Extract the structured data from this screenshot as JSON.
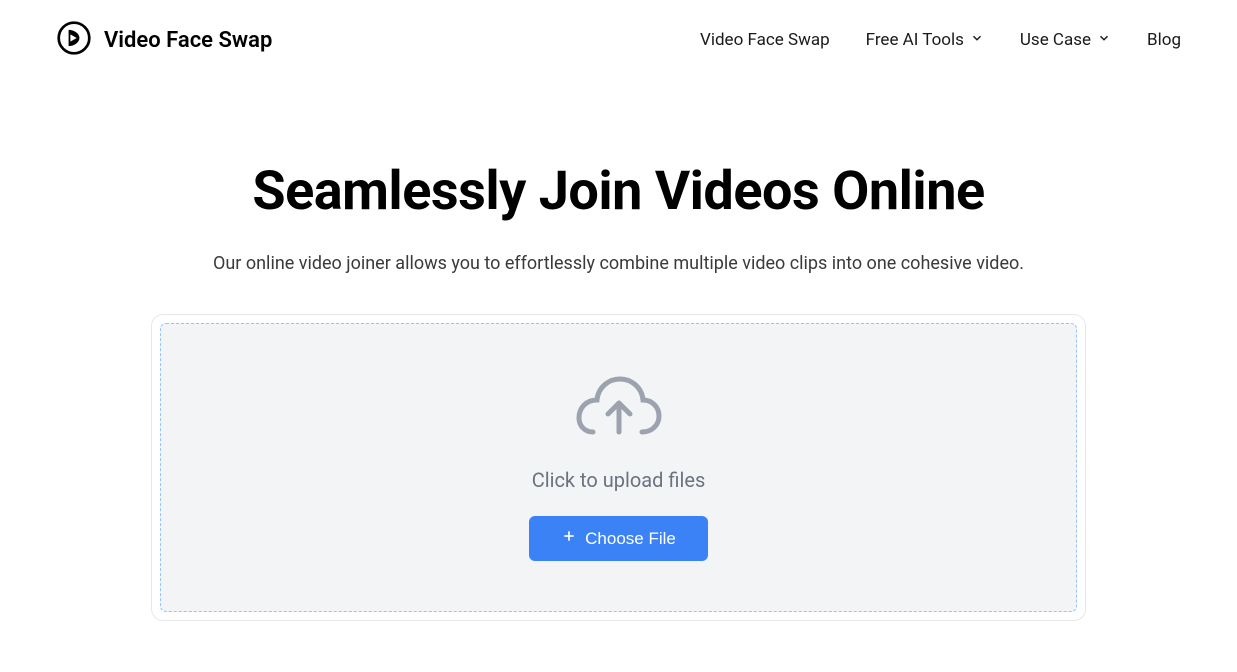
{
  "header": {
    "logo_text": "Video Face Swap",
    "nav": {
      "video_face_swap": "Video Face Swap",
      "free_ai_tools": "Free AI Tools",
      "use_case": "Use Case",
      "blog": "Blog"
    }
  },
  "hero": {
    "title": "Seamlessly Join Videos Online",
    "subtitle": "Our online video joiner allows you to effortlessly combine multiple video clips into one cohesive video."
  },
  "upload": {
    "prompt": "Click to upload files",
    "button_label": "Choose File"
  }
}
